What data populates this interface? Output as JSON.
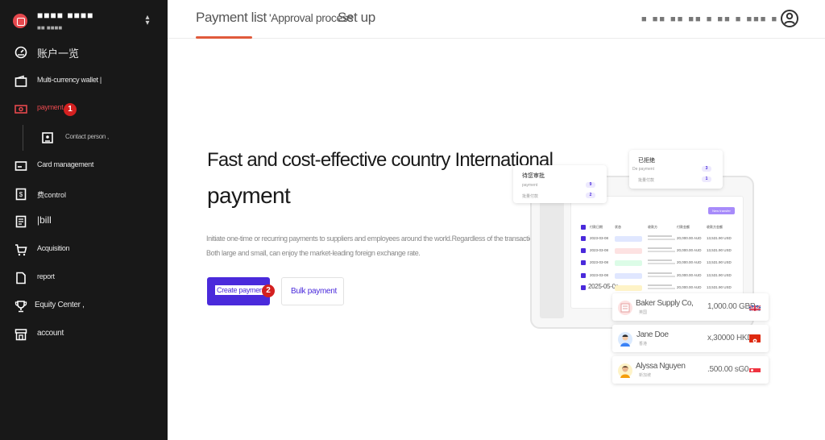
{
  "sidebar": {
    "org_name": "■■■■ ■■■■",
    "org_sub": "■■ ■■■■",
    "items": [
      {
        "label": "账户一览",
        "icon": "dashboard-gauge-icon"
      },
      {
        "label": "Multi-currency wallet |",
        "icon": "wallet-icon"
      },
      {
        "label": "payment",
        "icon": "payment-cash-icon"
      },
      {
        "label": "Contact person ,",
        "icon": "contact-card-icon"
      },
      {
        "label": "Card management",
        "icon": "credit-card-icon"
      },
      {
        "label": "费control",
        "icon": "expense-control-icon"
      },
      {
        "label": "|bill",
        "icon": "bill-document-icon"
      },
      {
        "label": "Acquisition",
        "icon": "shopping-cart-icon"
      },
      {
        "label": "report",
        "icon": "report-file-icon"
      },
      {
        "label": "Equity Center ,",
        "icon": "trophy-icon"
      },
      {
        "label": "account",
        "icon": "storefront-icon"
      }
    ],
    "badge_1": "1"
  },
  "topbar": {
    "tabs": [
      "Payment list",
      "'Approval process",
      "Set up"
    ],
    "user_name": "■ ■■ ■■ ■■ ■ ■■ ■ ■■■ ■"
  },
  "hero": {
    "title_line1": "Fast and cost-effective country International",
    "title_line2": "payment",
    "desc_line1": "Initiate one-time or recurring payments to suppliers and employees around the world.Regardless of the transaction",
    "desc_line2": "Both large and small, can enjoy the market-leading foreign exchange rate.",
    "create_button": "Create payment",
    "bulk_button": "Bulk payment",
    "badge_2": "2"
  },
  "illustration": {
    "pending_card": {
      "title": "待您审批",
      "row1_label": "payment",
      "row1_count": "9",
      "row2_label": "批量付款",
      "row2_count": "2"
    },
    "rejected_card": {
      "title": "已拒绝",
      "row1_label": "De payment",
      "row1_count": "3",
      "row2_label": "批量付款",
      "row2_count": "1"
    },
    "new_transfer_button": "New transfer",
    "table_headers": [
      "付款日期",
      "状态",
      "收款方",
      "付款金额",
      "收款方金额"
    ],
    "table_rows": [
      {
        "date": "2023-03-08",
        "chip": "#e0e7ff",
        "amount": "20,000.00 AUD",
        "amount2": "13,531.90 USD"
      },
      {
        "date": "2023-03-08",
        "chip": "#fde2e2",
        "amount": "20,000.00 AUD",
        "amount2": "13,531.90 USD"
      },
      {
        "date": "2023-03-08",
        "chip": "#dcfce7",
        "amount": "20,000.00 AUD",
        "amount2": "13,531.90 USD"
      },
      {
        "date": "2023-03-08",
        "chip": "#e0e7ff",
        "amount": "20,000.00 AUD",
        "amount2": "13,531.90 USD"
      },
      {
        "date": "2025-05-0a",
        "chip": "#fef3c7",
        "amount": "20,000.00 AUD",
        "amount2": "13,531.90 USD"
      }
    ],
    "payees": [
      {
        "name": "Baker Supply Co,",
        "sub": "英国",
        "amount": "1,000.00 GBP",
        "flag": "uk-flag-icon",
        "avatar": "building-avatar-icon"
      },
      {
        "name": "Jane Doe",
        "sub": "香港",
        "amount": "x,30000 HKD",
        "flag": "hk-flag-icon",
        "avatar": "person-avatar-icon"
      },
      {
        "name": "Alyssa Nguyen",
        "sub": "新加坡",
        "amount": ".500.00 sG0",
        "flag": "sg-flag-icon",
        "avatar": "person-avatar-icon"
      }
    ]
  },
  "colors": {
    "sidebar_bg": "#181818",
    "accent": "#e5484d",
    "primary": "#4a2adb",
    "tab_underline": "#e05a3b",
    "badge": "#d42020"
  }
}
